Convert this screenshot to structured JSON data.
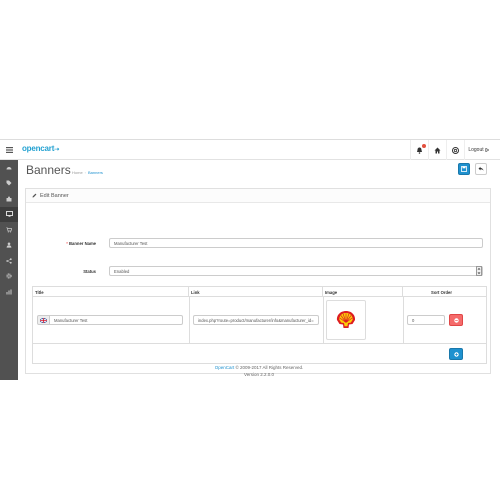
{
  "topbar": {
    "logo_text": "opencart",
    "logo_cart": "⇢",
    "logout_label": "Logout"
  },
  "sidebar": {
    "icons": [
      "dashboard-icon",
      "tags-icon",
      "puzzle-icon",
      "desktop-icon",
      "shopping-cart-icon",
      "user-icon",
      "share-icon",
      "cog-icon",
      "bar-chart-icon"
    ],
    "active_index": 3
  },
  "header": {
    "title": "Banners",
    "breadcrumb": [
      "Home",
      "Banners"
    ]
  },
  "panel": {
    "heading": "Edit Banner",
    "banner_name_label": "Banner Name",
    "banner_name_value": "Manufacturer Test",
    "status_label": "Status",
    "status_value": "Enabled"
  },
  "table": {
    "columns": [
      "Title",
      "Link",
      "Image",
      "Sort Order"
    ],
    "rows": [
      {
        "title": "Manufacturer Test",
        "link": "index.php?route=product/manufacturer/info&manufacturer_id=",
        "sort_order": "0"
      }
    ]
  },
  "footer": {
    "brand": "OpenCart",
    "copyright": " © 2009-2017 All Rights Reserved.",
    "version": "Version 2.2.0.0"
  },
  "colors": {
    "primary": "#1e91cf",
    "danger": "#f56b6b",
    "sidebar": "#515151"
  }
}
